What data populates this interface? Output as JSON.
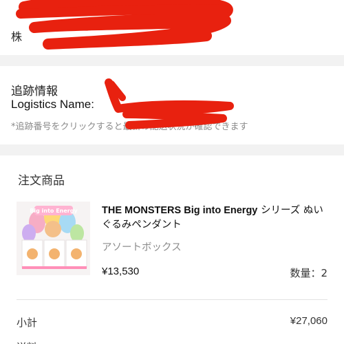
{
  "address": {
    "label_partial": "株"
  },
  "tracking": {
    "title": "追跡情報",
    "logistics_label": "Logistics Name:",
    "note": "*追跡番号をクリックすると最新の配送状況が確認できます"
  },
  "order_items": {
    "title": "注文商品",
    "product": {
      "name_en": "THE MONSTERS Big into Energy",
      "name_jp": " シリーズ ぬいぐるみペンダント",
      "variant": "アソートボックス",
      "price": "¥13,530",
      "quantity": "数量：2",
      "thumb_logo": "Big into Energy"
    },
    "subtotal_label": "小計",
    "subtotal_value": "¥27,060",
    "next_row_label": "送料"
  },
  "colors": {
    "redaction": "#e8210f",
    "muted": "#8a8a8a",
    "page_bg": "#f2f2f2"
  }
}
